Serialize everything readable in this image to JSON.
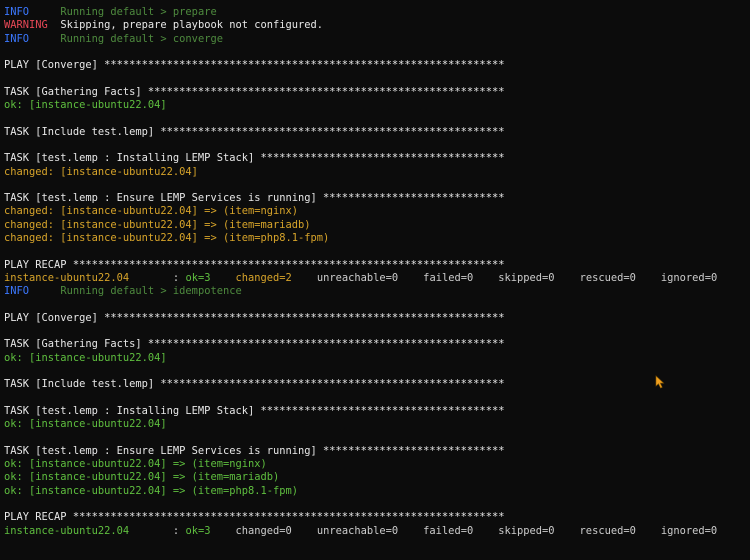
{
  "colors": {
    "info": "#3b78ff",
    "warning": "#e74856",
    "dim": "#4e8a3e",
    "white": "#e8e8e8",
    "ok": "#5fbf3f",
    "changed": "#d7a42a",
    "background": "#0c0c0c",
    "cursor": "#f0a020"
  },
  "icons": {
    "cursor": "mouse-pointer-icon"
  },
  "lines": [
    [
      {
        "t": "INFO     ",
        "c": "info"
      },
      {
        "t": "Running default > prepare",
        "c": "dim"
      }
    ],
    [
      {
        "t": "WARNING  ",
        "c": "warn"
      },
      {
        "t": "Skipping, prepare playbook not configured.",
        "c": "white"
      }
    ],
    [
      {
        "t": "INFO     ",
        "c": "info"
      },
      {
        "t": "Running default > converge",
        "c": "dim"
      }
    ],
    [],
    [
      {
        "t": "PLAY [Converge] ****************************************************************",
        "c": "white"
      }
    ],
    [],
    [
      {
        "t": "TASK [Gathering Facts] *********************************************************",
        "c": "white"
      }
    ],
    [
      {
        "t": "ok: [instance-ubuntu22.04]",
        "c": "green"
      }
    ],
    [],
    [
      {
        "t": "TASK [Include test.lemp] *******************************************************",
        "c": "white"
      }
    ],
    [],
    [
      {
        "t": "TASK [test.lemp : Installing LEMP Stack] ***************************************",
        "c": "white"
      }
    ],
    [
      {
        "t": "changed: [instance-ubuntu22.04]",
        "c": "yellow"
      }
    ],
    [],
    [
      {
        "t": "TASK [test.lemp : Ensure LEMP Services is running] *****************************",
        "c": "white"
      }
    ],
    [
      {
        "t": "changed: [instance-ubuntu22.04] => (item=nginx)",
        "c": "yellow"
      }
    ],
    [
      {
        "t": "changed: [instance-ubuntu22.04] => (item=mariadb)",
        "c": "yellow"
      }
    ],
    [
      {
        "t": "changed: [instance-ubuntu22.04] => (item=php8.1-fpm)",
        "c": "yellow"
      }
    ],
    [],
    [
      {
        "t": "PLAY RECAP *********************************************************************",
        "c": "white"
      }
    ],
    [
      {
        "t": "instance-ubuntu22.04",
        "c": "yellow"
      },
      {
        "t": "       : ",
        "c": "plain"
      },
      {
        "t": "ok=3",
        "c": "green"
      },
      {
        "t": "    ",
        "c": "plain"
      },
      {
        "t": "changed=2",
        "c": "yellow"
      },
      {
        "t": "    unreachable=0    failed=0    skipped=0    rescued=0    ignored=0",
        "c": "plain"
      }
    ],
    [
      {
        "t": "INFO     ",
        "c": "info"
      },
      {
        "t": "Running default > idempotence",
        "c": "dim"
      }
    ],
    [],
    [
      {
        "t": "PLAY [Converge] ****************************************************************",
        "c": "white"
      }
    ],
    [],
    [
      {
        "t": "TASK [Gathering Facts] *********************************************************",
        "c": "white"
      }
    ],
    [
      {
        "t": "ok: [instance-ubuntu22.04]",
        "c": "green"
      }
    ],
    [],
    [
      {
        "t": "TASK [Include test.lemp] *******************************************************",
        "c": "white"
      }
    ],
    [],
    [
      {
        "t": "TASK [test.lemp : Installing LEMP Stack] ***************************************",
        "c": "white"
      }
    ],
    [
      {
        "t": "ok: [instance-ubuntu22.04]",
        "c": "green"
      }
    ],
    [],
    [
      {
        "t": "TASK [test.lemp : Ensure LEMP Services is running] *****************************",
        "c": "white"
      }
    ],
    [
      {
        "t": "ok: [instance-ubuntu22.04] => (item=nginx)",
        "c": "green"
      }
    ],
    [
      {
        "t": "ok: [instance-ubuntu22.04] => (item=mariadb)",
        "c": "green"
      }
    ],
    [
      {
        "t": "ok: [instance-ubuntu22.04] => (item=php8.1-fpm)",
        "c": "green"
      }
    ],
    [],
    [
      {
        "t": "PLAY RECAP *********************************************************************",
        "c": "white"
      }
    ],
    [
      {
        "t": "instance-ubuntu22.04",
        "c": "green"
      },
      {
        "t": "       : ",
        "c": "plain"
      },
      {
        "t": "ok=3",
        "c": "green"
      },
      {
        "t": "    changed=0    unreachable=0    failed=0    skipped=0    rescued=0    ignored=0",
        "c": "plain"
      }
    ]
  ]
}
